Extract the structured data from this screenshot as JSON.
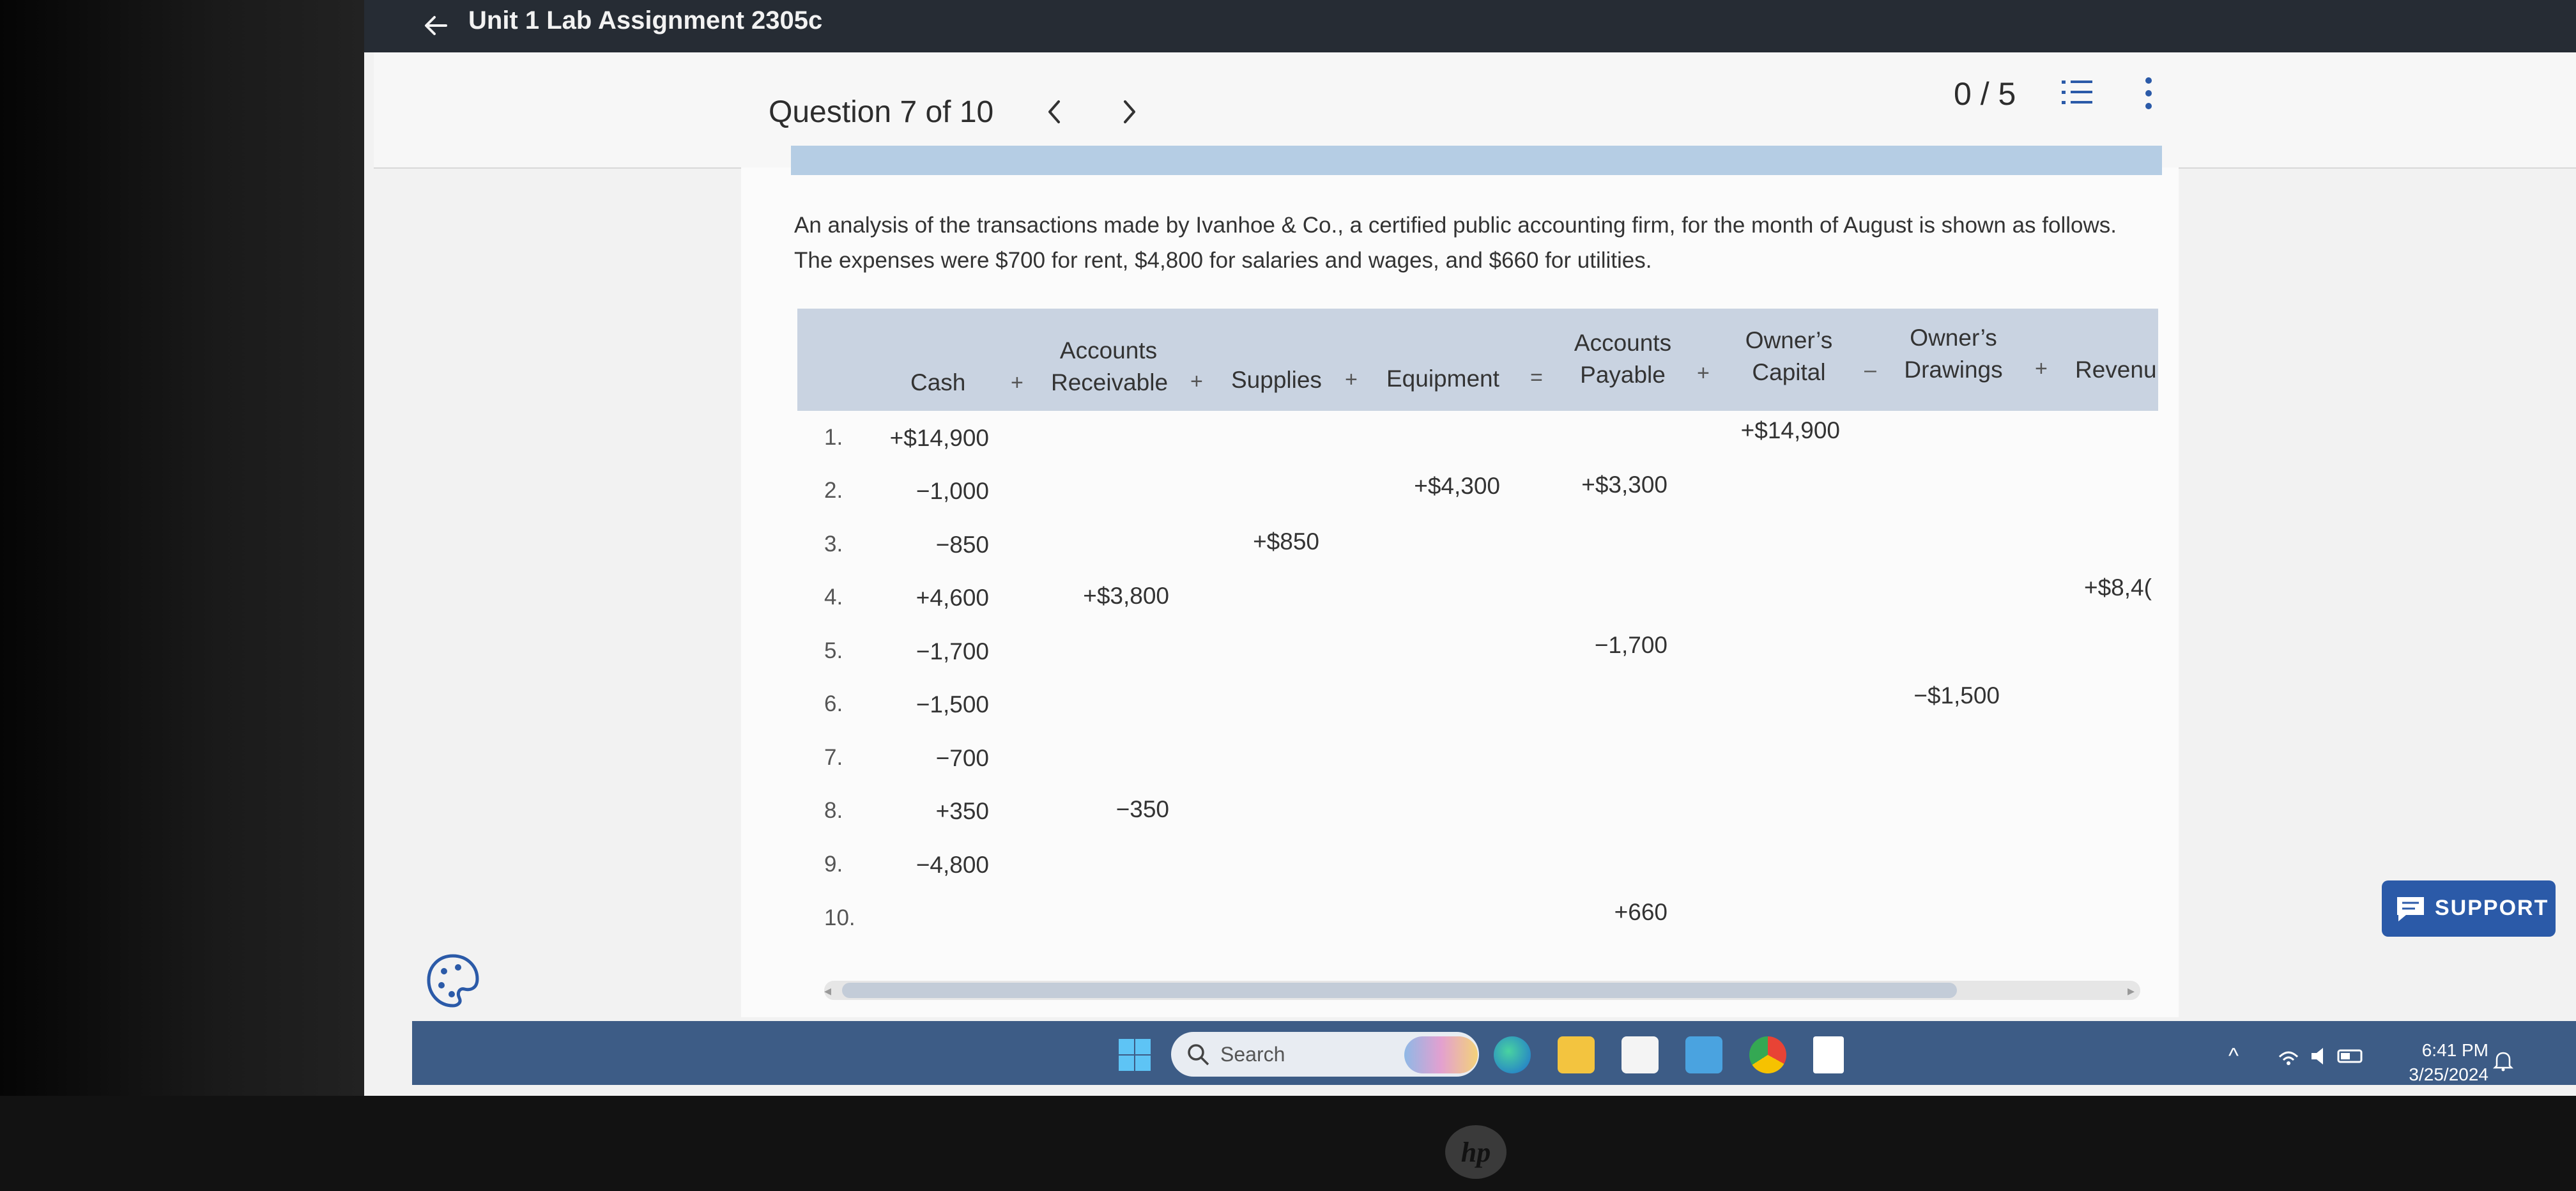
{
  "header": {
    "course_title": "Unit 1 Lab Assignment 2305c"
  },
  "question_nav": {
    "label": "Question 7 of 10",
    "prev": "‹",
    "next": "›",
    "score": "0 / 5"
  },
  "problem_text": [
    "An analysis of the transactions made by Ivanhoe & Co., a certified public accounting firm, for the month of August is shown as follows.",
    "The expenses were $700 for rent, $4,800 for salaries and wages, and $660 for utilities."
  ],
  "table": {
    "headers": {
      "cash": "Cash",
      "ar_1": "Accounts",
      "ar_2": "Receivable",
      "supplies": "Supplies",
      "equipment": "Equipment",
      "ap_1": "Accounts",
      "ap_2": "Payable",
      "capital_1": "Owner’s",
      "capital_2": "Capital",
      "drawings_1": "Owner’s",
      "drawings_2": "Drawings",
      "revenue": "Revenu"
    },
    "operators": {
      "plus": "+",
      "equals": "=",
      "minus": "–"
    },
    "rows": [
      {
        "num": "1.",
        "cash": "+$14,900",
        "ar": "",
        "supplies": "",
        "equipment": "",
        "ap": "",
        "capital": "+$14,900",
        "drawings": "",
        "revenue": ""
      },
      {
        "num": "2.",
        "cash": "−1,000",
        "ar": "",
        "supplies": "",
        "equipment": "+$4,300",
        "ap": "+$3,300",
        "capital": "",
        "drawings": "",
        "revenue": ""
      },
      {
        "num": "3.",
        "cash": "−850",
        "ar": "",
        "supplies": "+$850",
        "equipment": "",
        "ap": "",
        "capital": "",
        "drawings": "",
        "revenue": ""
      },
      {
        "num": "4.",
        "cash": "+4,600",
        "ar": "+$3,800",
        "supplies": "",
        "equipment": "",
        "ap": "",
        "capital": "",
        "drawings": "",
        "revenue": "+$8,4("
      },
      {
        "num": "5.",
        "cash": "−1,700",
        "ar": "",
        "supplies": "",
        "equipment": "",
        "ap": "−1,700",
        "capital": "",
        "drawings": "",
        "revenue": ""
      },
      {
        "num": "6.",
        "cash": "−1,500",
        "ar": "",
        "supplies": "",
        "equipment": "",
        "ap": "",
        "capital": "",
        "drawings": "−$1,500",
        "revenue": ""
      },
      {
        "num": "7.",
        "cash": "−700",
        "ar": "",
        "supplies": "",
        "equipment": "",
        "ap": "",
        "capital": "",
        "drawings": "",
        "revenue": ""
      },
      {
        "num": "8.",
        "cash": "+350",
        "ar": "−350",
        "supplies": "",
        "equipment": "",
        "ap": "",
        "capital": "",
        "drawings": "",
        "revenue": ""
      },
      {
        "num": "9.",
        "cash": "−4,800",
        "ar": "",
        "supplies": "",
        "equipment": "",
        "ap": "",
        "capital": "",
        "drawings": "",
        "revenue": ""
      },
      {
        "num": "10.",
        "cash": "",
        "ar": "",
        "supplies": "",
        "equipment": "",
        "ap": "+660",
        "capital": "",
        "drawings": "",
        "revenue": ""
      }
    ]
  },
  "support_label": "SUPPORT",
  "taskbar": {
    "search_placeholder": "Search",
    "time": "6:41 PM",
    "date": "3/25/2024"
  },
  "colors": {
    "topbar": "#262c34",
    "support": "#2b5aa8",
    "taskbar": "#3d5c86",
    "table_header": "#c9d3e1"
  }
}
